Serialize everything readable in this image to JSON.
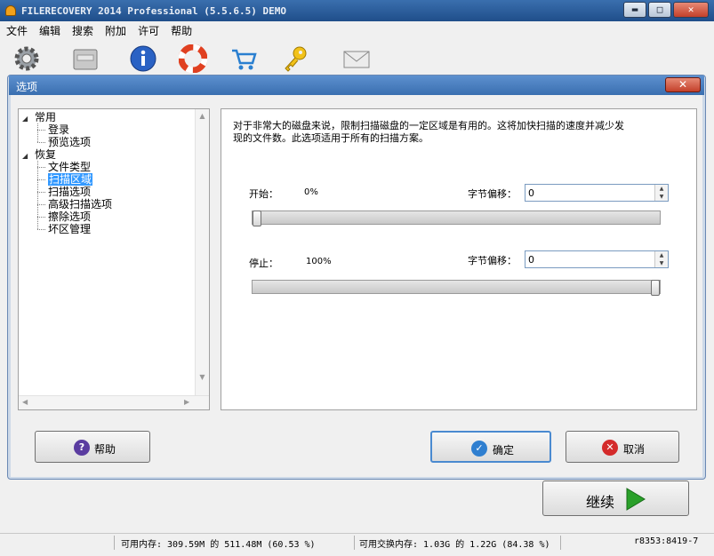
{
  "window": {
    "title": "FILERECOVERY 2014 Professional (5.5.6.5) DEMO",
    "min": "▬",
    "max": "□",
    "close": "✕"
  },
  "menu": [
    "文件",
    "编辑",
    "搜索",
    "附加",
    "许可",
    "帮助"
  ],
  "toolbar": {
    "icons": [
      "gear-icon",
      "drive-icon",
      "info-icon",
      "lifebuoy-icon",
      "cart-icon",
      "key-icon",
      "mail-icon"
    ]
  },
  "dialog": {
    "title": "选项",
    "close": "✕",
    "tree": {
      "groups": [
        {
          "label": "常用",
          "items": [
            "登录",
            "预览选项"
          ]
        },
        {
          "label": "恢复",
          "items": [
            "文件类型",
            "扫描区域",
            "扫描选项",
            "高级扫描选项",
            "擦除选项",
            "坏区管理"
          ]
        }
      ],
      "selected": "扫描区域"
    },
    "description": [
      "对于非常大的磁盘来说，限制扫描磁盘的一定区域是有用的。这将加快扫描的速度并减少发",
      "现的文件数。此选项适用于所有的扫描方案。"
    ],
    "start": {
      "label": "开始：",
      "value": "0%",
      "offset_label": "字节偏移：",
      "offset_value": "0",
      "slider_fraction": 0
    },
    "stop": {
      "label": "停止：",
      "value": "100%",
      "offset_label": "字节偏移：",
      "offset_value": "0",
      "slider_fraction": 1
    },
    "buttons": {
      "help": "帮助",
      "ok": "确定",
      "cancel": "取消"
    }
  },
  "continue_button": "继续",
  "status": {
    "memory": "可用内存: 309.59M 的 511.48M (60.53 %)",
    "swap": "可用交换内存: 1.03G 的 1.22G (84.38 %)",
    "right": "r8353:8419-7"
  },
  "colors": {
    "accent_blue": "#3a6fb0",
    "selection": "#3399ff",
    "ok_icon": "#2f7fd0",
    "cancel_icon": "#d42a2a",
    "help_icon": "#5a3ca0",
    "continue_arrow": "#2aa02a"
  }
}
